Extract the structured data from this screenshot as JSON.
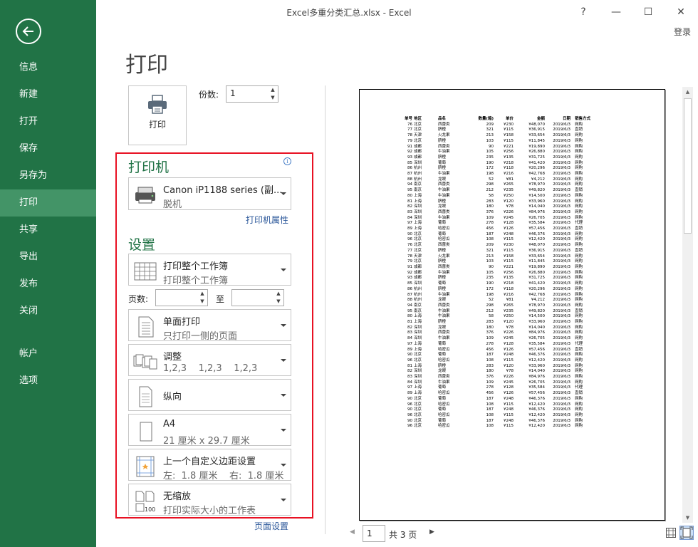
{
  "window": {
    "title": "Excel多重分类汇总.xlsx - Excel",
    "help": "?",
    "minimize": "—",
    "maximize": "☐",
    "close": "✕",
    "login": "登录"
  },
  "nav": {
    "items": [
      "信息",
      "新建",
      "打开",
      "保存",
      "另存为",
      "打印",
      "共享",
      "导出",
      "发布",
      "关闭"
    ],
    "active": "打印",
    "bottom_items": [
      "帐户",
      "选项"
    ]
  },
  "print": {
    "page_title": "打印",
    "print_button": "打印",
    "copies_label": "份数:",
    "copies_value": "1",
    "printer_heading": "打印机",
    "printer_name": "Canon iP1188 series (副...",
    "printer_status": "脱机",
    "printer_properties": "打印机属性",
    "settings_heading": "设置",
    "what_title": "打印整个工作簿",
    "what_sub": "打印整个工作簿",
    "pages_label": "页数:",
    "pages_from": "",
    "pages_to_label": "至",
    "pages_to": "",
    "sides_title": "单面打印",
    "sides_sub": "只打印一侧的页面",
    "collate_title": "调整",
    "collate_sub": "1,2,3    1,2,3    1,2,3",
    "orientation_title": "纵向",
    "paper_title": "A4",
    "paper_sub": "21 厘米 x 29.7 厘米",
    "margins_title": "上一个自定义边距设置",
    "margins_sub": "左:  1.8 厘米    右:  1.8 厘米",
    "scaling_title": "无缩放",
    "scaling_sub": "打印实际大小的工作表",
    "page_setup": "页面设置"
  },
  "preview": {
    "page_number": "1",
    "total_pages": "共 3 页",
    "headers": [
      "单号",
      "地区",
      "品名",
      "数量(箱)",
      "单价",
      "金额",
      "日期",
      "销售方式"
    ],
    "rows": [
      [
        "76",
        "北京",
        "西蕾类",
        "209",
        "¥230",
        "¥48,070",
        "2019/6/3",
        "网购"
      ],
      [
        "77",
        "北京",
        "脐橙",
        "321",
        "¥115",
        "¥36,915",
        "2019/6/3",
        "直销"
      ],
      [
        "78",
        "天津",
        "火龙果",
        "213",
        "¥158",
        "¥33,654",
        "2019/6/3",
        "网购"
      ],
      [
        "79",
        "北京",
        "脐橙",
        "103",
        "¥115",
        "¥11,845",
        "2019/6/3",
        "网购"
      ],
      [
        "91",
        "成都",
        "西蕾类",
        "90",
        "¥221",
        "¥19,890",
        "2019/6/3",
        "网购"
      ],
      [
        "92",
        "成都",
        "牛油果",
        "105",
        "¥256",
        "¥26,880",
        "2019/6/3",
        "网购"
      ],
      [
        "93",
        "成都",
        "脐橙",
        "235",
        "¥135",
        "¥31,725",
        "2019/6/3",
        "网购"
      ],
      [
        "85",
        "深圳",
        "葡萄",
        "190",
        "¥218",
        "¥41,420",
        "2019/6/3",
        "网购"
      ],
      [
        "86",
        "杭州",
        "脐橙",
        "172",
        "¥118",
        "¥20,296",
        "2019/6/3",
        "网购"
      ],
      [
        "87",
        "杭州",
        "牛油果",
        "198",
        "¥216",
        "¥42,768",
        "2019/6/3",
        "网购"
      ],
      [
        "88",
        "杭州",
        "龙眼",
        "52",
        "¥81",
        "¥4,212",
        "2019/6/3",
        "网购"
      ],
      [
        "94",
        "南京",
        "西蕾类",
        "298",
        "¥265",
        "¥78,970",
        "2019/6/3",
        "网购"
      ],
      [
        "95",
        "南京",
        "牛油果",
        "212",
        "¥235",
        "¥49,820",
        "2019/6/3",
        "直销"
      ],
      [
        "80",
        "上海",
        "牛油果",
        "58",
        "¥250",
        "¥14,500",
        "2019/6/3",
        "网购"
      ],
      [
        "81",
        "上海",
        "脐橙",
        "283",
        "¥120",
        "¥33,960",
        "2019/6/3",
        "网购"
      ],
      [
        "82",
        "深圳",
        "龙眼",
        "180",
        "¥78",
        "¥14,040",
        "2019/6/3",
        "网购"
      ],
      [
        "83",
        "深圳",
        "西蕾类",
        "376",
        "¥226",
        "¥84,976",
        "2019/6/3",
        "网购"
      ],
      [
        "84",
        "深圳",
        "牛油果",
        "109",
        "¥245",
        "¥26,705",
        "2019/6/3",
        "网购"
      ],
      [
        "97",
        "上海",
        "葡萄",
        "278",
        "¥128",
        "¥35,584",
        "2019/6/3",
        "代理"
      ],
      [
        "89",
        "上海",
        "哈密瓜",
        "456",
        "¥126",
        "¥57,456",
        "2019/6/3",
        "直销"
      ],
      [
        "90",
        "北京",
        "葡萄",
        "187",
        "¥248",
        "¥46,376",
        "2019/6/3",
        "网购"
      ],
      [
        "96",
        "北京",
        "哈密瓜",
        "108",
        "¥115",
        "¥12,420",
        "2019/6/3",
        "网购"
      ],
      [
        "76",
        "北京",
        "西蕾类",
        "209",
        "¥230",
        "¥48,070",
        "2019/6/3",
        "网购"
      ],
      [
        "77",
        "北京",
        "脐橙",
        "321",
        "¥115",
        "¥36,915",
        "2019/6/3",
        "直销"
      ],
      [
        "78",
        "天津",
        "火龙果",
        "213",
        "¥158",
        "¥33,654",
        "2019/6/3",
        "网购"
      ],
      [
        "79",
        "北京",
        "脐橙",
        "103",
        "¥115",
        "¥11,845",
        "2019/6/3",
        "网购"
      ],
      [
        "91",
        "成都",
        "西蕾类",
        "90",
        "¥221",
        "¥19,890",
        "2019/6/3",
        "网购"
      ],
      [
        "92",
        "成都",
        "牛油果",
        "105",
        "¥256",
        "¥26,880",
        "2019/6/3",
        "网购"
      ],
      [
        "93",
        "成都",
        "脐橙",
        "235",
        "¥135",
        "¥31,725",
        "2019/6/3",
        "网购"
      ],
      [
        "85",
        "深圳",
        "葡萄",
        "190",
        "¥218",
        "¥41,420",
        "2019/6/3",
        "网购"
      ],
      [
        "86",
        "杭州",
        "脐橙",
        "172",
        "¥118",
        "¥20,296",
        "2019/6/3",
        "网购"
      ],
      [
        "87",
        "杭州",
        "牛油果",
        "198",
        "¥216",
        "¥42,768",
        "2019/6/3",
        "网购"
      ],
      [
        "88",
        "杭州",
        "龙眼",
        "52",
        "¥81",
        "¥4,212",
        "2019/6/3",
        "网购"
      ],
      [
        "94",
        "南京",
        "西蕾类",
        "298",
        "¥265",
        "¥78,970",
        "2019/6/3",
        "网购"
      ],
      [
        "95",
        "南京",
        "牛油果",
        "212",
        "¥235",
        "¥49,820",
        "2019/6/3",
        "直销"
      ],
      [
        "80",
        "上海",
        "牛油果",
        "58",
        "¥250",
        "¥14,500",
        "2019/6/3",
        "网购"
      ],
      [
        "81",
        "上海",
        "脐橙",
        "283",
        "¥120",
        "¥33,960",
        "2019/6/3",
        "网购"
      ],
      [
        "82",
        "深圳",
        "龙眼",
        "180",
        "¥78",
        "¥14,040",
        "2019/6/3",
        "网购"
      ],
      [
        "83",
        "深圳",
        "西蕾类",
        "376",
        "¥226",
        "¥84,976",
        "2019/6/3",
        "网购"
      ],
      [
        "84",
        "深圳",
        "牛油果",
        "109",
        "¥245",
        "¥26,705",
        "2019/6/3",
        "网购"
      ],
      [
        "97",
        "上海",
        "葡萄",
        "278",
        "¥128",
        "¥35,584",
        "2019/6/3",
        "代理"
      ],
      [
        "89",
        "上海",
        "哈密瓜",
        "456",
        "¥126",
        "¥57,456",
        "2019/6/3",
        "直销"
      ],
      [
        "90",
        "北京",
        "葡萄",
        "187",
        "¥248",
        "¥46,376",
        "2019/6/3",
        "网购"
      ],
      [
        "96",
        "北京",
        "哈密瓜",
        "108",
        "¥115",
        "¥12,420",
        "2019/6/3",
        "网购"
      ],
      [
        "81",
        "上海",
        "脐橙",
        "283",
        "¥120",
        "¥33,960",
        "2019/6/3",
        "网购"
      ],
      [
        "82",
        "深圳",
        "龙眼",
        "180",
        "¥78",
        "¥14,040",
        "2019/6/3",
        "网购"
      ],
      [
        "83",
        "深圳",
        "西蕾类",
        "376",
        "¥226",
        "¥84,976",
        "2019/6/3",
        "网购"
      ],
      [
        "84",
        "深圳",
        "牛油果",
        "109",
        "¥245",
        "¥26,705",
        "2019/6/3",
        "网购"
      ],
      [
        "97",
        "上海",
        "葡萄",
        "278",
        "¥128",
        "¥35,584",
        "2019/6/3",
        "代理"
      ],
      [
        "89",
        "上海",
        "哈密瓜",
        "456",
        "¥126",
        "¥57,456",
        "2019/6/3",
        "直销"
      ],
      [
        "90",
        "北京",
        "葡萄",
        "187",
        "¥248",
        "¥46,376",
        "2019/6/3",
        "网购"
      ],
      [
        "96",
        "北京",
        "哈密瓜",
        "108",
        "¥115",
        "¥12,420",
        "2019/6/3",
        "网购"
      ],
      [
        "90",
        "北京",
        "葡萄",
        "187",
        "¥248",
        "¥46,376",
        "2019/6/3",
        "网购"
      ],
      [
        "96",
        "北京",
        "哈密瓜",
        "108",
        "¥115",
        "¥12,420",
        "2019/6/3",
        "网购"
      ],
      [
        "90",
        "北京",
        "葡萄",
        "187",
        "¥248",
        "¥46,376",
        "2019/6/3",
        "网购"
      ],
      [
        "96",
        "北京",
        "哈密瓜",
        "108",
        "¥115",
        "¥12,420",
        "2019/6/3",
        "网购"
      ]
    ]
  },
  "colors": {
    "nav_bg": "#217346",
    "nav_active": "#439467",
    "accent_green": "#217346",
    "highlight_red": "#e81123",
    "link_blue": "#2b579a"
  }
}
